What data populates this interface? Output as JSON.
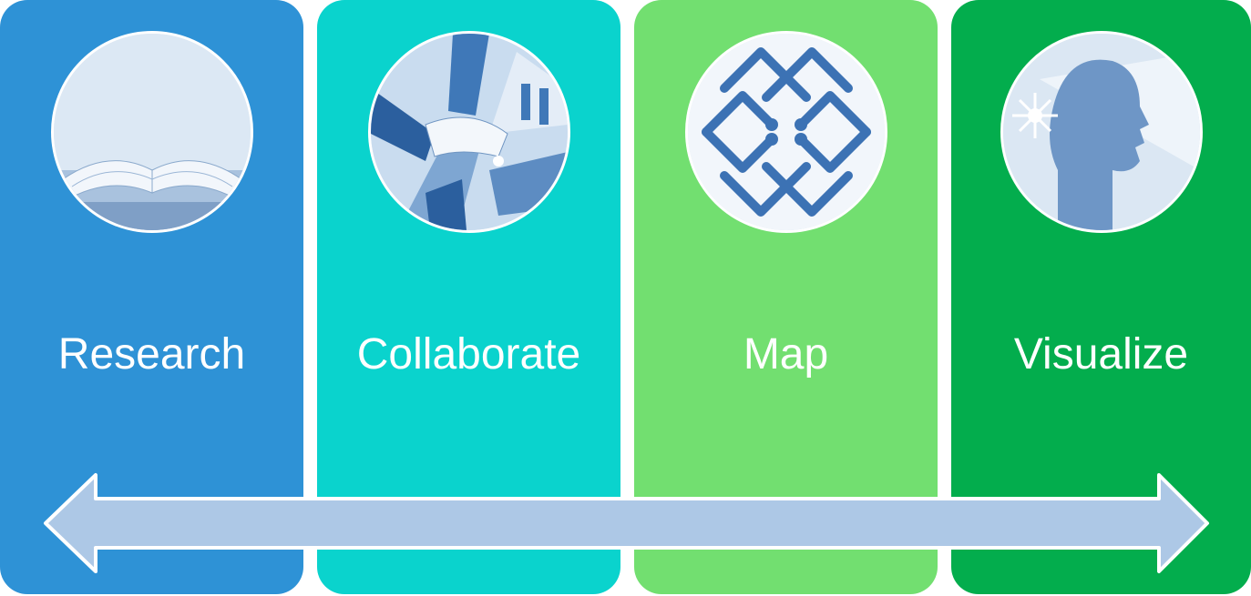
{
  "steps": [
    {
      "label": "Research",
      "color": "#2e92d6",
      "icon": "open-book"
    },
    {
      "label": "Collaborate",
      "color": "#0ad3cd",
      "icon": "stacked-hands"
    },
    {
      "label": "Map",
      "color": "#72df70",
      "icon": "interlocking-network"
    },
    {
      "label": "Visualize",
      "color": "#03ad4d",
      "icon": "head-with-light"
    }
  ],
  "arrow": {
    "type": "double-headed",
    "color": "#adc8e6"
  }
}
